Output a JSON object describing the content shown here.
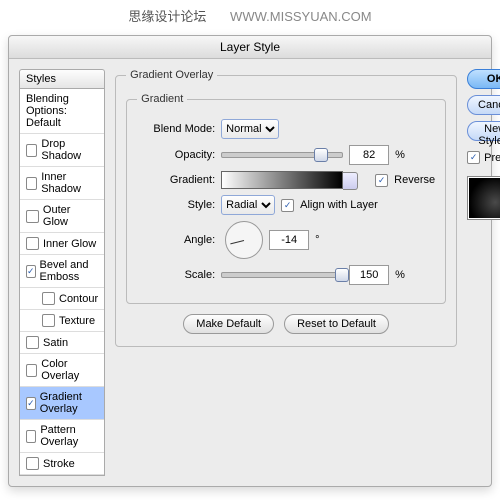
{
  "watermark": {
    "cn": "思缘设计论坛",
    "url": "WWW.MISSYUAN.COM"
  },
  "window": {
    "title": "Layer Style"
  },
  "styles": {
    "header": "Styles",
    "blending": "Blending Options: Default",
    "items": [
      {
        "label": "Drop Shadow",
        "checked": false
      },
      {
        "label": "Inner Shadow",
        "checked": false
      },
      {
        "label": "Outer Glow",
        "checked": false
      },
      {
        "label": "Inner Glow",
        "checked": false
      },
      {
        "label": "Bevel and Emboss",
        "checked": true
      },
      {
        "label": "Contour",
        "checked": false,
        "sub": true
      },
      {
        "label": "Texture",
        "checked": false,
        "sub": true
      },
      {
        "label": "Satin",
        "checked": false
      },
      {
        "label": "Color Overlay",
        "checked": false
      },
      {
        "label": "Gradient Overlay",
        "checked": true,
        "selected": true
      },
      {
        "label": "Pattern Overlay",
        "checked": false
      },
      {
        "label": "Stroke",
        "checked": false
      }
    ]
  },
  "panel": {
    "title": "Gradient Overlay",
    "group": "Gradient",
    "blendMode": {
      "label": "Blend Mode:",
      "value": "Normal"
    },
    "opacity": {
      "label": "Opacity:",
      "value": "82",
      "suffix": "%",
      "pos": 82
    },
    "gradient": {
      "label": "Gradient:",
      "reverse": "Reverse",
      "reverseOn": true
    },
    "style": {
      "label": "Style:",
      "value": "Radial",
      "align": "Align with Layer",
      "alignOn": true
    },
    "angle": {
      "label": "Angle:",
      "value": "-14",
      "suffix": "°"
    },
    "scale": {
      "label": "Scale:",
      "value": "150",
      "suffix": "%",
      "pos": 100
    },
    "buttons": {
      "makeDefault": "Make Default",
      "reset": "Reset to Default"
    }
  },
  "right": {
    "ok": "OK",
    "cancel": "Cancel",
    "newStyle": "New Style...",
    "preview": "Preview",
    "previewOn": true
  }
}
